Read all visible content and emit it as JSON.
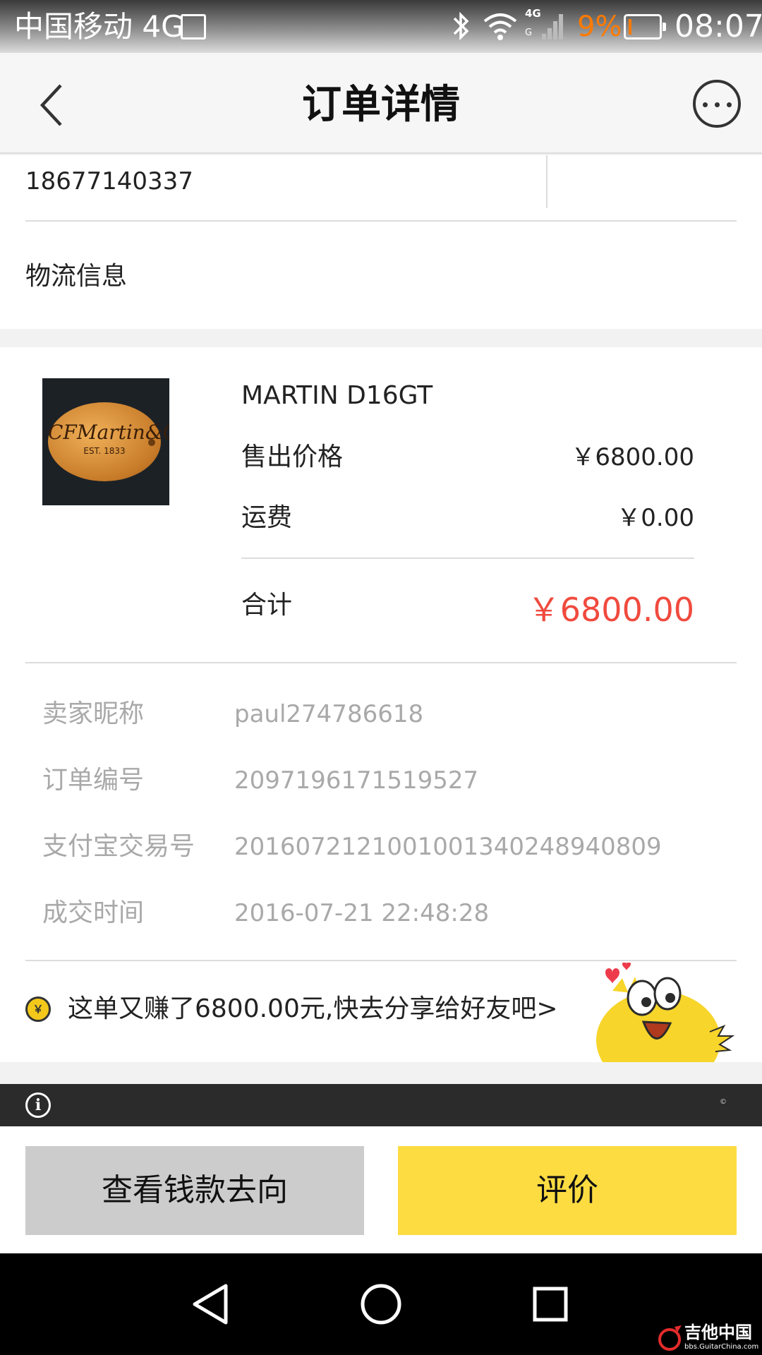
{
  "status_bar": {
    "carrier": "中国移动 4G",
    "battery_percent": "9%",
    "time": "08:07",
    "icons": [
      "sim-icon",
      "bluetooth-icon",
      "wifi-icon",
      "signal-4g-icon",
      "battery-icon"
    ],
    "accent_color": "#ff7a00"
  },
  "nav": {
    "title": "订单详情",
    "back_icon": "back-arrow-icon",
    "more_icon": "more-icon"
  },
  "contact": {
    "phone": "18677140337"
  },
  "logistics": {
    "label": "物流信息"
  },
  "product": {
    "name": "MARTIN D16GT",
    "image": {
      "brand_text": "CFMartin&Co",
      "est_text": "EST. 1833"
    },
    "price_label": "售出价格",
    "price_value": "￥6800.00",
    "shipping_label": "运费",
    "shipping_value": "￥0.00",
    "total_label": "合计",
    "total_value": "￥6800.00",
    "total_color": "#f04a3e"
  },
  "order_info": [
    {
      "label": "卖家昵称",
      "value": "paul274786618"
    },
    {
      "label": "订单编号",
      "value": "2097196171519527"
    },
    {
      "label": "支付宝交易号",
      "value": "2016072121001001340248940809"
    },
    {
      "label": "成交时间",
      "value": "2016-07-21 22:48:28"
    }
  ],
  "share": {
    "coin_symbol": "￥",
    "text": "这单又赚了6800.00元,快去分享给好友吧>"
  },
  "tip_bar": {
    "icon": "info-icon",
    "info_glyph": "i",
    "mark": "©"
  },
  "actions": {
    "view_funds_label": "查看钱款去向",
    "review_label": "评价",
    "review_color": "#fddc42"
  },
  "system_nav": {
    "keys": [
      "back-triangle-icon",
      "home-circle-icon",
      "recents-square-icon"
    ]
  },
  "watermark": {
    "title": "吉他中国",
    "url": "bbs.GuitarChina.com"
  }
}
